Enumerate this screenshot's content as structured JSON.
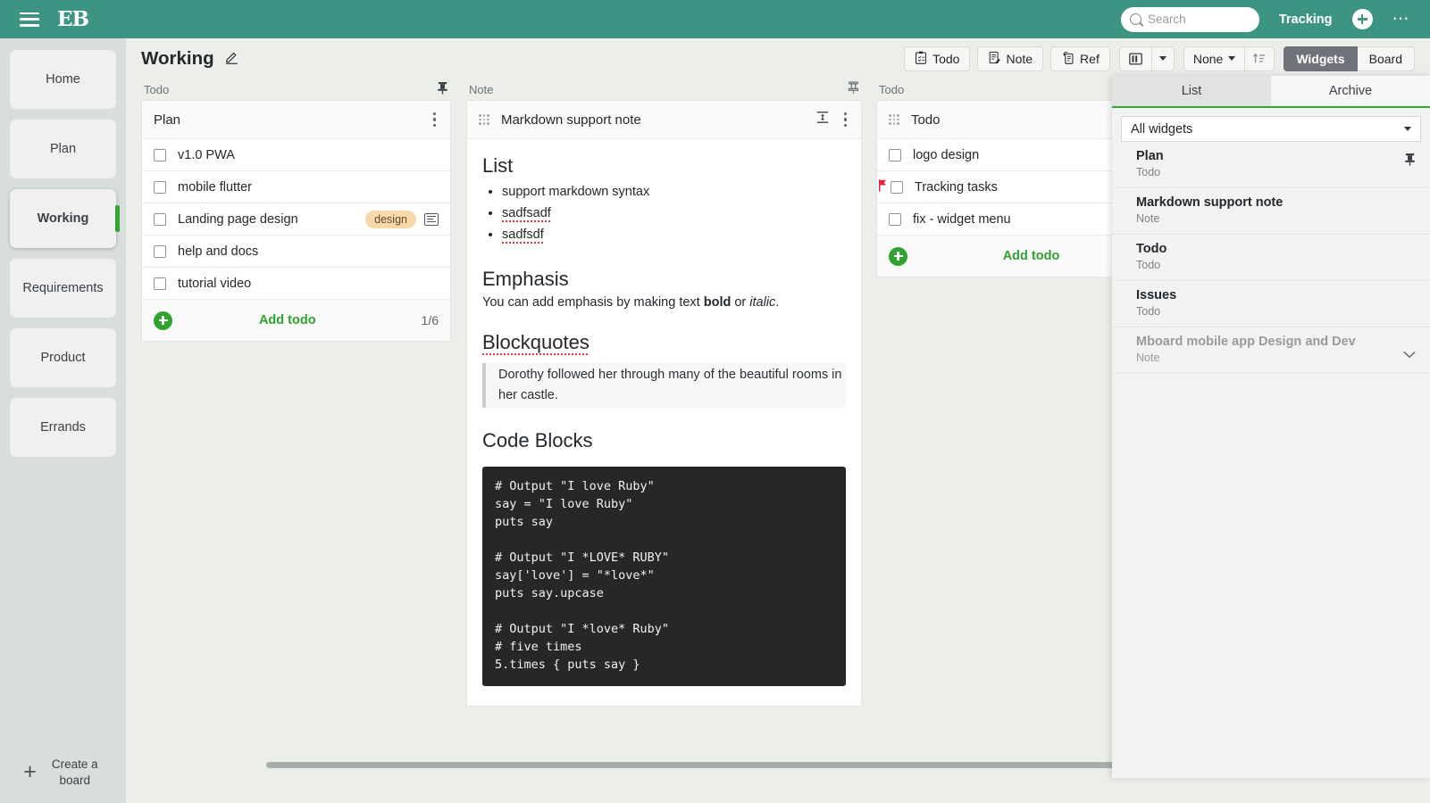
{
  "topbar": {
    "menu_icon": "hamburger-icon",
    "brand": "EB",
    "search_placeholder": "Search",
    "search_value": "",
    "tracking_label": "Tracking",
    "add_icon": "plus-icon",
    "more_icon": "ellipsis-icon"
  },
  "sidebar": {
    "items": [
      {
        "label": "Home",
        "active": false
      },
      {
        "label": "Plan",
        "active": false
      },
      {
        "label": "Working",
        "active": true
      },
      {
        "label": "Requirements",
        "active": false
      },
      {
        "label": "Product",
        "active": false
      },
      {
        "label": "Errands",
        "active": false
      }
    ],
    "create_board_label": "Create a board",
    "accent_color": "#33a532"
  },
  "board": {
    "title": "Working",
    "edit_icon": "pencil-icon",
    "add_buttons": [
      {
        "label": "Todo",
        "icon": "clipboard-check-icon"
      },
      {
        "label": "Note",
        "icon": "note-edit-icon"
      },
      {
        "label": "Ref",
        "icon": "reference-copy-icon"
      }
    ],
    "layout_icon": "column-layout-icon",
    "group_label": "None",
    "sort_icon": "sort-ascending-icon",
    "view_modes": [
      {
        "label": "Widgets",
        "selected": true
      },
      {
        "label": "Board",
        "selected": false
      }
    ]
  },
  "columns": [
    {
      "header": "Todo",
      "pinned": true,
      "card": {
        "title": "Plan",
        "menu_icon": "kebab-menu-icon",
        "todos": [
          {
            "text": "v1.0 PWA",
            "checked": false,
            "tag": null,
            "flagged": false,
            "has_note": false
          },
          {
            "text": "mobile flutter",
            "checked": false,
            "tag": null,
            "flagged": false,
            "has_note": false
          },
          {
            "text": "Landing page design",
            "checked": false,
            "tag": "design",
            "flagged": false,
            "has_note": true
          },
          {
            "text": "help and docs",
            "checked": false,
            "tag": null,
            "flagged": false,
            "has_note": false
          },
          {
            "text": "tutorial video",
            "checked": false,
            "tag": null,
            "flagged": false,
            "has_note": false
          }
        ],
        "add_label": "Add todo",
        "count": "1/6"
      }
    },
    {
      "header": "Note",
      "pinned": true,
      "card": {
        "title": "Markdown support note",
        "grip_icon": "drag-handle-icon",
        "collapse_icon": "fit-height-icon",
        "menu_icon": "kebab-menu-icon",
        "note": {
          "h_list": "List",
          "list_items": [
            {
              "text": "support markdown syntax",
              "misspelled": false
            },
            {
              "text": "sadfsadf",
              "misspelled": true
            },
            {
              "text": "sadfsdf",
              "misspelled": true
            }
          ],
          "h_emphasis": "Emphasis",
          "emphasis_pre": "You can add emphasis by making text ",
          "emphasis_bold": "bold",
          "emphasis_mid": " or ",
          "emphasis_italic": "italic",
          "emphasis_post": ".",
          "h_blockquotes": "Blockquotes",
          "blockquote": "Dorothy followed her through many of the beautiful rooms in her castle.",
          "h_code": "Code Blocks",
          "code": "# Output \"I love Ruby\"\nsay = \"I love Ruby\"\nputs say\n\n# Output \"I *LOVE* RUBY\"\nsay['love'] = \"*love*\"\nputs say.upcase\n\n# Output \"I *love* Ruby\"\n# five times\n5.times { puts say }"
        }
      }
    },
    {
      "header": "Todo",
      "pinned": false,
      "card": {
        "title": "Todo",
        "grip_icon": "drag-handle-icon",
        "todos": [
          {
            "text": "logo design",
            "checked": false,
            "tag": null,
            "flagged": false,
            "has_note": false
          },
          {
            "text": "Tracking tasks",
            "checked": false,
            "tag": null,
            "flagged": true,
            "has_note": false
          },
          {
            "text": "fix - widget menu",
            "checked": false,
            "tag": null,
            "flagged": false,
            "has_note": false
          }
        ],
        "add_label": "Add todo"
      }
    }
  ],
  "panel": {
    "tabs": [
      {
        "label": "List",
        "selected": true
      },
      {
        "label": "Archive",
        "selected": false
      }
    ],
    "filter_value": "All widgets",
    "filter_caret": "chevron-down-icon",
    "widgets": [
      {
        "name": "Plan",
        "type": "Todo",
        "pinned": true,
        "dimmed": false,
        "action_icon": "pin-icon"
      },
      {
        "name": "Markdown support note",
        "type": "Note",
        "pinned": false,
        "dimmed": false,
        "action_icon": null
      },
      {
        "name": "Todo",
        "type": "Todo",
        "pinned": false,
        "dimmed": false,
        "action_icon": null
      },
      {
        "name": "Issues",
        "type": "Todo",
        "pinned": false,
        "dimmed": false,
        "action_icon": null
      },
      {
        "name": "Mboard mobile app Design and Dev",
        "type": "Note",
        "pinned": false,
        "dimmed": true,
        "action_icon": "chevron-expand-icon"
      }
    ]
  },
  "colors": {
    "brand_teal": "#3d9482",
    "green_accent": "#33a532",
    "tag_orange": "#fad9a8",
    "flag_red": "#e0233c",
    "code_bg": "#272727"
  }
}
